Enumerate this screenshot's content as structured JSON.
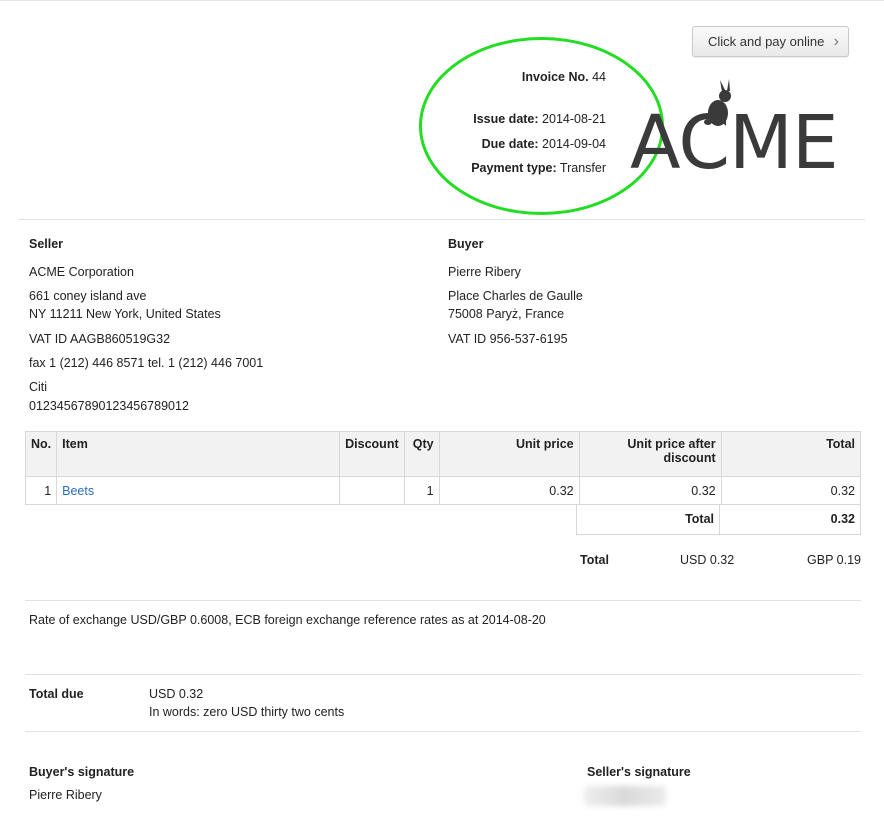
{
  "pay_button": {
    "label": "Click and pay online",
    "chevron": "›"
  },
  "invoice": {
    "number_label": "Invoice No.",
    "number": "44",
    "issue_label": "Issue date:",
    "issue": "2014-08-21",
    "due_label": "Due date:",
    "due": "2014-09-04",
    "payment_label": "Payment type:",
    "payment": "Transfer"
  },
  "logo": {
    "text": "ACME",
    "icon": "rabbit-icon"
  },
  "seller": {
    "heading": "Seller",
    "name": "ACME Corporation",
    "address1": "661 coney island ave",
    "address2": "NY 11211 New York, United States",
    "vat": "VAT ID AAGB860519G32",
    "contact": "fax 1 (212) 446 8571 tel. 1 (212) 446 7001",
    "bank": "Citi",
    "account": "0123456789012345678901 2",
    "account_fixed": "01234567890123456789012"
  },
  "buyer": {
    "heading": "Buyer",
    "name": "Pierre Ribery",
    "address1": "Place Charles de Gaulle",
    "address2": "75008 Paryż, France",
    "vat": "VAT ID 956-537-6195"
  },
  "table": {
    "headers": {
      "no": "No.",
      "item": "Item",
      "discount": "Discount",
      "qty": "Qty",
      "unit_price": "Unit price",
      "unit_after_1": "Unit price after",
      "unit_after_2": "discount",
      "total": "Total"
    },
    "rows": [
      {
        "no": "1",
        "item": "Beets",
        "discount": "",
        "qty": "1",
        "unit_price": "0.32",
        "unit_after": "0.32",
        "total": "0.32"
      }
    ],
    "sum_label": "Total",
    "sum_value": "0.32"
  },
  "totals": {
    "label": "Total",
    "usd": "USD 0.32",
    "gbp": "GBP 0.19"
  },
  "exchange_note": "Rate of exchange USD/GBP 0.6008, ECB foreign exchange reference rates as at 2014-08-20",
  "total_due": {
    "label": "Total due",
    "amount": "USD 0.32",
    "words": "In words: zero USD thirty two cents"
  },
  "signatures": {
    "buyer_label": "Buyer's signature",
    "buyer_name": "Pierre Ribery",
    "seller_label": "Seller's signature"
  },
  "colors": {
    "highlight": "#22dd22",
    "link": "#2a6fb8",
    "logo": "#3a3a3a"
  }
}
